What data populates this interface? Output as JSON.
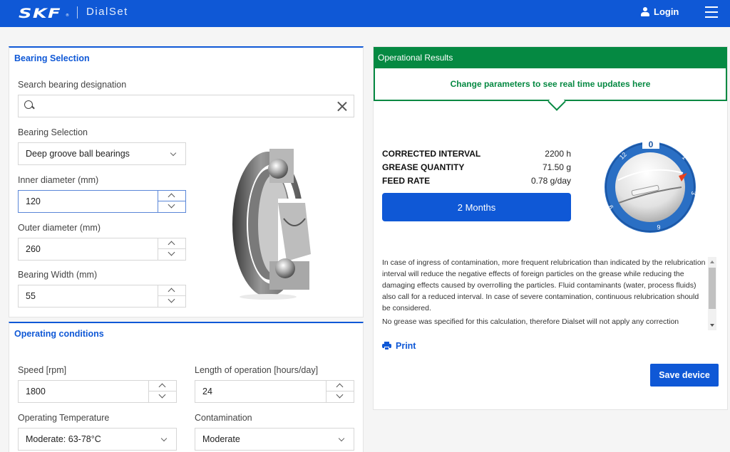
{
  "header": {
    "brand": "SKF",
    "brand_mark": "®",
    "app_name": "DialSet",
    "login_label": "Login",
    "icons": {
      "user": "user-icon",
      "menu": "hamburger-menu-icon"
    }
  },
  "bearing_selection": {
    "title": "Bearing Selection",
    "search": {
      "label": "Search bearing designation",
      "value": "",
      "placeholder": ""
    },
    "type": {
      "label": "Bearing Selection",
      "value": "Deep groove ball bearings"
    },
    "inner_diameter": {
      "label": "Inner diameter (mm)",
      "value": "120"
    },
    "outer_diameter": {
      "label": "Outer diameter (mm)",
      "value": "260"
    },
    "width": {
      "label": "Bearing Width (mm)",
      "value": "55"
    },
    "image": "deep-groove-ball-bearing-image"
  },
  "operating_conditions": {
    "title": "Operating conditions",
    "speed": {
      "label": "Speed [rpm]",
      "value": "1800"
    },
    "length": {
      "label": "Length of operation [hours/day]",
      "value": "24"
    },
    "temperature": {
      "label": "Operating Temperature",
      "value": "Moderate: 63-78°C"
    },
    "contamination": {
      "label": "Contamination",
      "value": "Moderate"
    }
  },
  "results": {
    "title": "Operational Results",
    "message": "Change parameters to see real time updates here",
    "metrics": [
      {
        "label": "CORRECTED INTERVAL",
        "value": "2200 h"
      },
      {
        "label": "GREASE QUANTITY",
        "value": "71.50 g"
      },
      {
        "label": "FEED RATE",
        "value": "0.78 g/day"
      }
    ],
    "interval_button": "2 Months",
    "dial": {
      "labels": [
        "0",
        "1",
        "3",
        "6",
        "9",
        "12"
      ],
      "setting_months": 2
    },
    "notes": [
      "In case of ingress of contamination, more frequent relubrication than indicated by the relubrication interval will reduce the negative effects of foreign particles on the grease while reducing the damaging effects caused by overrolling the particles. Fluid contaminants (water, process fluids) also call for a reduced interval. In case of severe contamination, continuous relubrication should be considered.",
      "No grease was specified for this calculation, therefore Dialset will not apply any correction"
    ],
    "print_label": "Print",
    "save_label": "Save device"
  },
  "colors": {
    "primary": "#0f58d6",
    "success": "#058942",
    "dial_accent": "#e8401c"
  }
}
